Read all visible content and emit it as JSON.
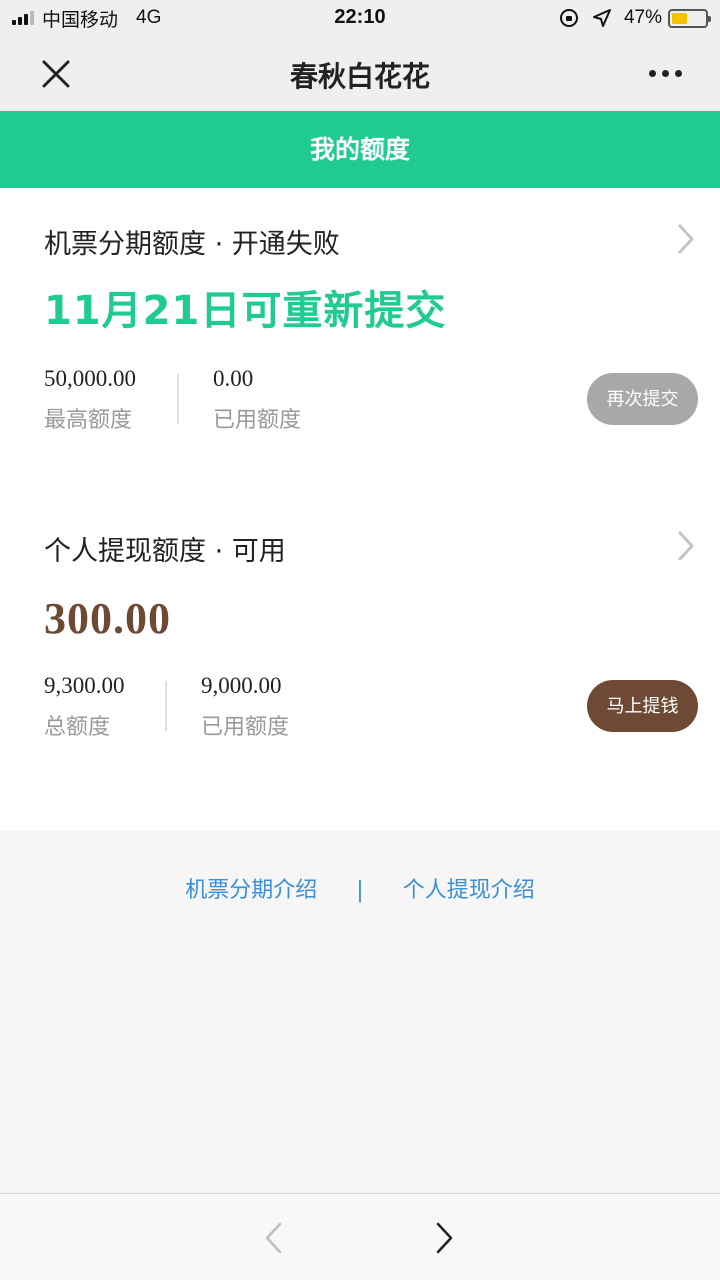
{
  "status_bar": {
    "carrier": "中国移动",
    "network": "4G",
    "time": "22:10",
    "battery_percent": "47%",
    "battery_level": 0.47,
    "battery_color": "#f6c200"
  },
  "nav": {
    "title": "春秋白花花",
    "close_icon": "close-icon",
    "more_icon": "more-icon"
  },
  "header": {
    "title": "我的额度",
    "color": "#1fcb91"
  },
  "cards": [
    {
      "title": "机票分期额度 · 开通失败",
      "main_text": "11月21日可重新提交",
      "main_color": "#1fcb91",
      "stats": [
        {
          "value": "50,000.00",
          "label": "最高额度"
        },
        {
          "value": "0.00",
          "label": "已用额度"
        }
      ],
      "button_label": "再次提交",
      "button_color": "#a8a8a8"
    },
    {
      "title": "个人提现额度 · 可用",
      "main_text": "300.00",
      "main_color": "#6e4a34",
      "stats": [
        {
          "value": "9,300.00",
          "label": "总额度"
        },
        {
          "value": "9,000.00",
          "label": "已用额度"
        }
      ],
      "button_label": "马上提钱",
      "button_color": "#6e4a34"
    }
  ],
  "links": {
    "left": "机票分期介绍",
    "separator": "|",
    "right": "个人提现介绍",
    "color": "#3b8fd6"
  },
  "bottom_bar": {
    "back_icon": "chevron-left-icon",
    "forward_icon": "chevron-right-icon"
  }
}
